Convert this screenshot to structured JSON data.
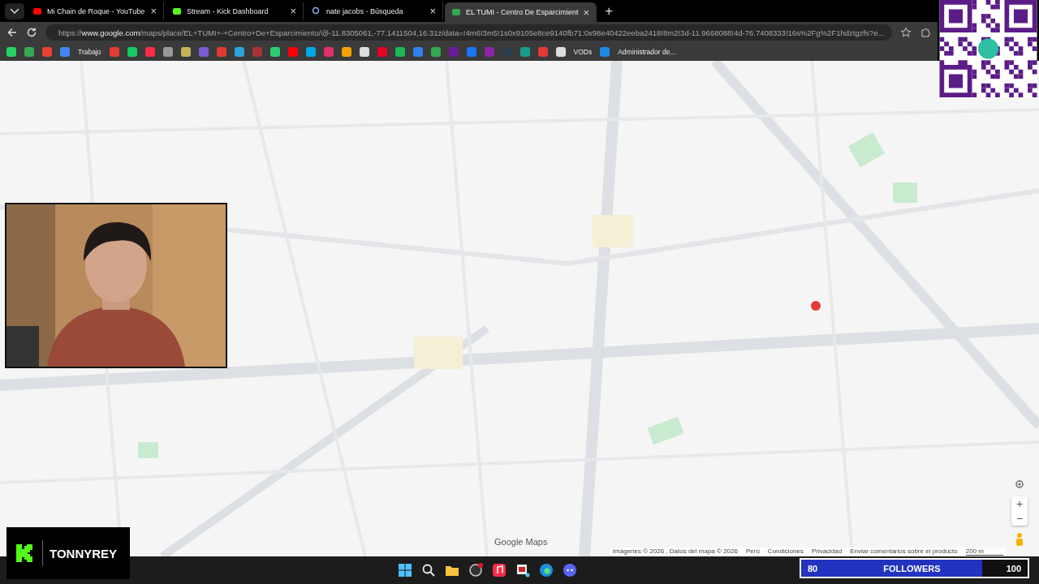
{
  "tabs": [
    {
      "title": "Mi Chain de Roque - YouTube",
      "selected": false,
      "close": "×"
    },
    {
      "title": "Stream - Kick Dashboard",
      "selected": false,
      "close": "×"
    },
    {
      "title": "nate jacobs - Búsqueda",
      "selected": false,
      "close": "×"
    },
    {
      "title": "EL TUMI - Centro De Esparcimient",
      "selected": true,
      "close": "×"
    }
  ],
  "new_tab": "+",
  "address": {
    "scheme": "https://",
    "host": "www.google.com",
    "path": "/maps/place/EL+TUMI+-+Centro+De+Esparcimiento/@-11.8305061,-77.1411504,16.31z/data=!4m6!3m5!1s0x9105e8ce9140fb71:0x98e40422eeba2418!8m2!3d-11.9668088!4d-76.7408333!16s%2Fg%2F1hdztgzfs?e..."
  },
  "bookmarks": [
    {
      "label": "Trabajo"
    },
    {
      "label": "VODs"
    },
    {
      "label": "Administrador de..."
    }
  ],
  "map": {
    "logo": "Google Maps",
    "zoom_in": "+",
    "zoom_out": "−",
    "attribution": [
      "Imágenes © 2026 , Datos del mapa © 2026",
      "Perú",
      "Condiciones",
      "Privacidad",
      "Enviar comentarios sobre el producto"
    ],
    "scale": "200 m"
  },
  "stream_overlay": {
    "channel": "TONNYREY",
    "followers": {
      "current": "80",
      "label": "FOLLOWERS",
      "goal": "100",
      "level": 0.8
    }
  }
}
